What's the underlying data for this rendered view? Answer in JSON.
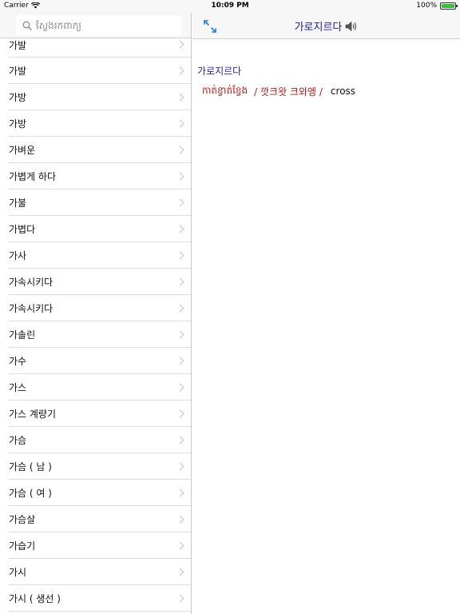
{
  "status_bar": {
    "carrier": "Carrier",
    "time": "10:09 PM",
    "battery": "100%",
    "battery_level": 1.0
  },
  "sidebar": {
    "search": {
      "placeholder": "ស្វែងរកពាក្យ",
      "value": ""
    },
    "items": [
      {
        "label": "가발"
      },
      {
        "label": "가발"
      },
      {
        "label": "가방"
      },
      {
        "label": "가방"
      },
      {
        "label": "가벼운"
      },
      {
        "label": "가볍게 하다"
      },
      {
        "label": "가불"
      },
      {
        "label": "가볍다"
      },
      {
        "label": "가사"
      },
      {
        "label": "가속시키다"
      },
      {
        "label": "가속시키다"
      },
      {
        "label": "가솔린"
      },
      {
        "label": "가수"
      },
      {
        "label": "가스"
      },
      {
        "label": "가스 계량기"
      },
      {
        "label": "가슴"
      },
      {
        "label": "가슴 ( 남 )"
      },
      {
        "label": "가슴 ( 여 )"
      },
      {
        "label": "가슴살"
      },
      {
        "label": "가습기"
      },
      {
        "label": "가시"
      },
      {
        "label": "가시 ( 생선 )"
      }
    ]
  },
  "detail": {
    "title": "가로지르다",
    "speaker_icon": "speaker-icon",
    "entry": {
      "headword": "가로지르다",
      "khmer": "កាត់ខ្វាត់ខ្វែង",
      "romanization": "/ 깟크왓 크와엥 /",
      "english": "cross"
    }
  },
  "colors": {
    "accent": "#1a7cf5",
    "title_blue": "#1a1aa8",
    "headword_blue": "#2424c8",
    "khmer_red": "#c01515"
  }
}
